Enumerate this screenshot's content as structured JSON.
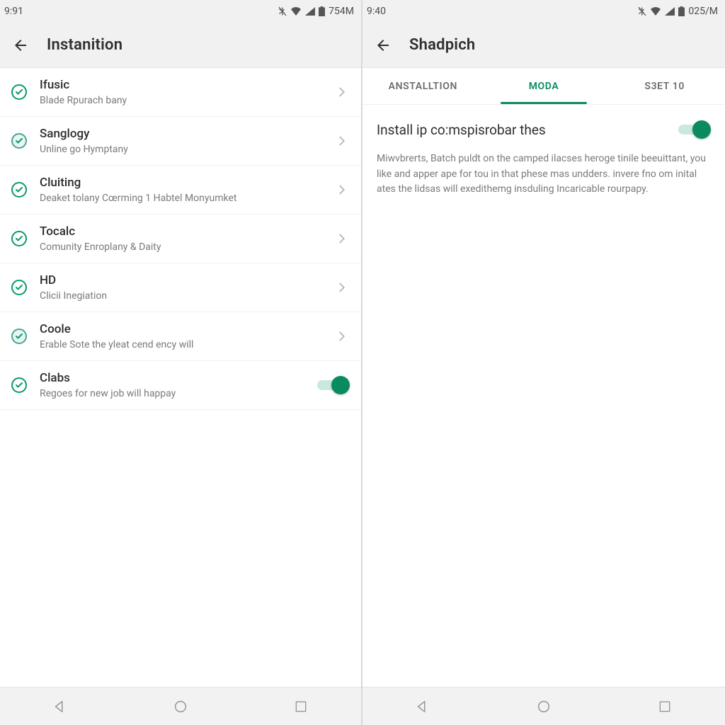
{
  "left": {
    "status": {
      "time": "9:91",
      "batt": "754M"
    },
    "header": {
      "title": "Instanition"
    },
    "items": [
      {
        "icon": "check",
        "title": "Ifusic",
        "subtitle": "Blade Rpurach bany",
        "tail": "chevron"
      },
      {
        "icon": "check-alt",
        "title": "Sanglogy",
        "subtitle": "Unline go Hymptany",
        "tail": "chevron"
      },
      {
        "icon": "check",
        "title": "Cluiting",
        "subtitle": "Deaket tolany Cœrming 1 Habtel Monyumket",
        "tail": "chevron"
      },
      {
        "icon": "check",
        "title": "Tocalc",
        "subtitle": "Comunity Enroplany & Daity",
        "tail": "chevron"
      },
      {
        "icon": "check",
        "title": "HD",
        "subtitle": "Clicii Inegiation",
        "tail": "chevron"
      },
      {
        "icon": "check-alt",
        "title": "Coole",
        "subtitle": "Erable Sote the yleat cend ency will",
        "tail": "chevron"
      },
      {
        "icon": "check",
        "title": "Clabs",
        "subtitle": "Regoes for new job will happay",
        "tail": "toggle"
      }
    ]
  },
  "right": {
    "status": {
      "time": "9:40",
      "batt": "025/M"
    },
    "header": {
      "title": "Shadpich"
    },
    "tabs": [
      {
        "label": "ANSTALLTION",
        "active": false
      },
      {
        "label": "MODA",
        "active": true
      },
      {
        "label": "S3ET 10",
        "active": false
      }
    ],
    "setting": {
      "label": "Install ip co:mspisrobar thes",
      "toggle": true,
      "description": "Miwvbrerts, Batch puldt on the camped ilacses heroge tinile beeuittant, you like and apper ape for tou in that phese mas undders. invere fno om inital ates the lidsas will exedithemg insduling Incaricable rourpapy."
    }
  }
}
